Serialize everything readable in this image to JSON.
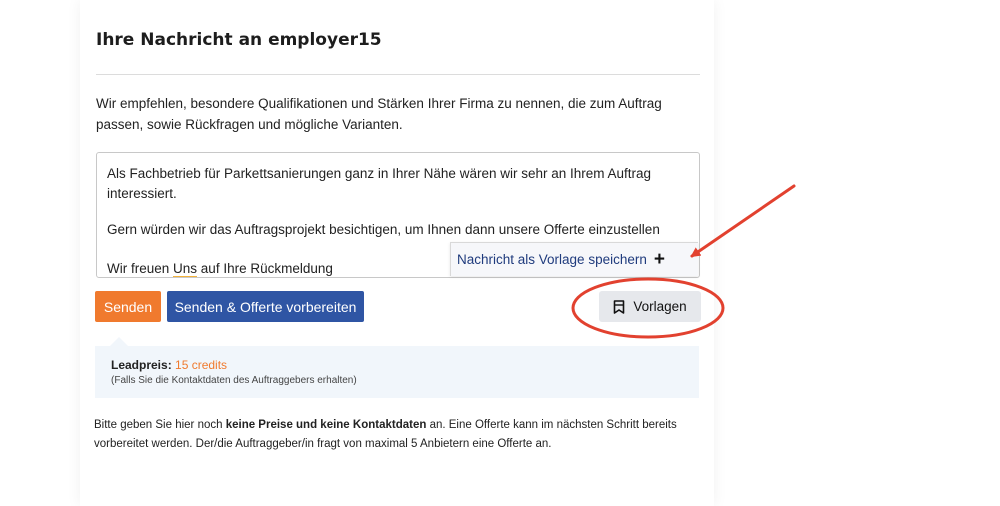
{
  "title": "Ihre Nachricht an employer15",
  "intro": "Wir empfehlen, besondere Qualifikationen und Stärken Ihrer Firma zu nennen, die zum Auftrag passen, sowie Rückfragen und mögliche Varianten.",
  "message": {
    "line1": "Als Fachbetrieb für Parkettsanierungen ganz in Ihrer Nähe wären wir sehr an Ihrem Auftrag",
    "line2": "interessiert.",
    "line3": "Gern würden wir das Auftragsprojekt besichtigen, um Ihnen dann unsere Offerte einzustellen",
    "line4_pre": "Wir freuen ",
    "line4_word": "Uns",
    "line4_post": " auf Ihre Rückmeldung"
  },
  "save_template": {
    "label": "Nachricht als Vorlage speichern",
    "plus": "+"
  },
  "buttons": {
    "send": "Senden",
    "send_offer": "Senden & Offerte vorbereiten",
    "templates": "Vorlagen"
  },
  "lead": {
    "label": "Leadpreis:",
    "credits": "15 credits",
    "note": "(Falls Sie die Kontaktdaten des Auftraggebers erhalten)"
  },
  "bottom": {
    "part1": "Bitte geben Sie hier noch ",
    "bold": "keine Preise und keine Kontaktdaten",
    "part2": " an. Eine Offerte kann im nächsten Schritt bereits vorbereitet werden. Der/die Auftraggeber/in fragt von maximal 5 Anbietern eine Offerte an."
  },
  "icons": {
    "templates": "bookmark-icon",
    "add": "plus-icon"
  },
  "colors": {
    "accent_orange": "#f07a2e",
    "primary_blue": "#2f55a4",
    "annotation_red": "#e2412f"
  }
}
